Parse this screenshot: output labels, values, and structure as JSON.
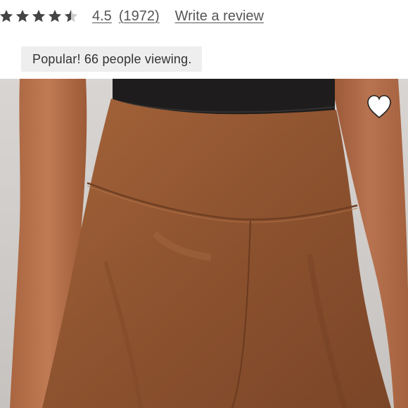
{
  "rating": {
    "value": "4.5",
    "review_count": "(1972)",
    "write_review_label": "Write a review",
    "stars": [
      1,
      1,
      1,
      1,
      0.5
    ],
    "star_icon": "star-icon",
    "star_color": "#444444",
    "star_empty_color": "#cccccc"
  },
  "badge": {
    "text": "Popular! 66 people viewing."
  },
  "product_image": {
    "icon": "product-photo"
  },
  "favorite": {
    "icon": "heart-icon",
    "color": "#ffffff"
  }
}
